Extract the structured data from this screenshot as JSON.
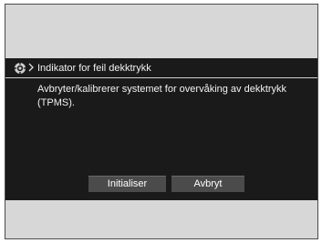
{
  "header": {
    "icon": "tire-pressure-wheel-icon",
    "breadcrumb_icon": "chevron-right-icon",
    "title": "Indikator for feil dekktrykk"
  },
  "body": {
    "message": "Avbryter/kalibrerer systemet for overvåking av dekktrykk (TPMS)."
  },
  "buttons": {
    "initialize_label": "Initialiser",
    "cancel_label": "Avbryt"
  },
  "colors": {
    "screen_bg": "#1a1a1a",
    "frame_bg": "#d7d7d7",
    "button_bg": "#4b4b4b",
    "text": "#f2f2f2"
  }
}
